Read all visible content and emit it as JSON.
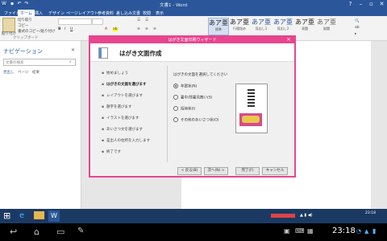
{
  "window": {
    "title": "文書1 - Word"
  },
  "ribbon_tabs": [
    "ファイル",
    "ホーム",
    "挿入",
    "デザイン",
    "ページレイアウト",
    "参考資料",
    "差し込み文書",
    "校閲",
    "表示"
  ],
  "ribbon": {
    "paste_label": "貼り付け",
    "cut_label": "切り取り",
    "copy_label": "コピー",
    "format_painter_label": "書式のコピー/貼り付け",
    "clipboard_group": "クリップボード",
    "styles": [
      {
        "sample": "あア亜",
        "label": "標準"
      },
      {
        "sample": "あア亜",
        "label": "行間詰め"
      },
      {
        "sample": "あア亜",
        "label": "見出し1"
      },
      {
        "sample": "あア亜",
        "label": "見出し2"
      },
      {
        "sample": "あア亜",
        "label": "表題"
      },
      {
        "sample": "あア亜",
        "label": "副題"
      }
    ]
  },
  "nav": {
    "title": "ナビゲーション",
    "search_placeholder": "文書の検索",
    "tabs": [
      "見出し",
      "ページ",
      "結果"
    ]
  },
  "dialog": {
    "title": "はがき文面印刷ウィザード",
    "heading": "はがき文面作成",
    "steps": [
      "始めましょう",
      "はがきの文面を選びます",
      "レイアウトを選びます",
      "題字を選びます",
      "イラストを選びます",
      "あいさつ文を選びます",
      "差出人の住所を入力します",
      "終了です"
    ],
    "current_step": 1,
    "prompt": "はがきの文面を選択してください",
    "options": [
      "年賀状(N)",
      "暑中/残暑見舞い(S)",
      "招待状(I)",
      "その他のあいさつ状(O)"
    ],
    "selected_option": 0,
    "buttons": [
      "< 戻る(B)",
      "次へ(N) >",
      "完了(F)",
      "キャンセル"
    ]
  },
  "taskbar": {
    "clock": "23:18",
    "tray_time_small": "23:18"
  },
  "colors": {
    "accent": "#2b579a",
    "dialog_border": "#e8458f"
  }
}
